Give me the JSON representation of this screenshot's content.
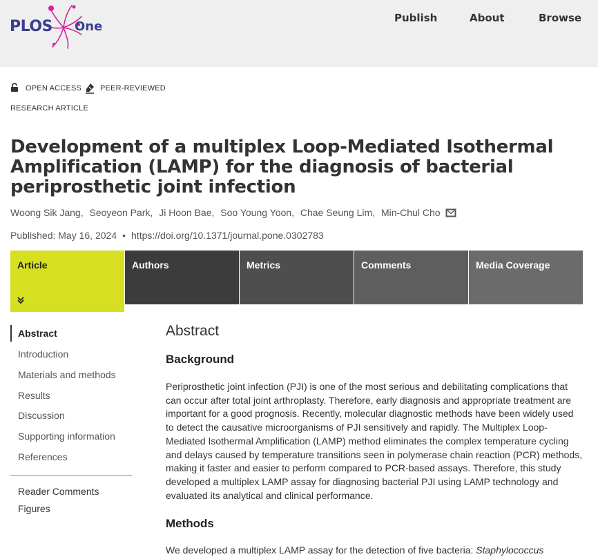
{
  "header": {
    "logo_text": "PLOS",
    "logo_sub": "One",
    "nav": [
      "Publish",
      "About",
      "Browse"
    ]
  },
  "badges": {
    "open_access": "OPEN ACCESS",
    "peer_reviewed": "PEER-REVIEWED"
  },
  "article_type": "RESEARCH ARTICLE",
  "title": "Development of a multiplex Loop-Mediated Isothermal Amplification (LAMP) for the diagnosis of bacterial periprosthetic joint infection",
  "authors": [
    "Woong Sik Jang,",
    "Seoyeon Park,",
    "Ji Hoon Bae,",
    "Soo Young Yoon,",
    "Chae Seung Lim,",
    "Min-Chul Cho"
  ],
  "published": {
    "date": "Published: May 16, 2024",
    "separator": "•",
    "doi": "https://doi.org/10.1371/journal.pone.0302783"
  },
  "tabs": [
    "Article",
    "Authors",
    "Metrics",
    "Comments",
    "Media Coverage"
  ],
  "sidenav": {
    "items": [
      "Abstract",
      "Introduction",
      "Materials and methods",
      "Results",
      "Discussion",
      "Supporting information",
      "References"
    ],
    "extra": [
      "Reader Comments",
      "Figures"
    ]
  },
  "main": {
    "abstract_heading": "Abstract",
    "background_heading": "Background",
    "background_text": "Periprosthetic joint infection (PJI) is one of the most serious and debilitating complications that can occur after total joint arthroplasty. Therefore, early diagnosis and appropriate treatment are important for a good prognosis. Recently, molecular diagnostic methods have been widely used to detect the causative microorganisms of PJI sensitively and rapidly. The Multiplex Loop-Mediated Isothermal Amplification (LAMP) method eliminates the complex temperature cycling and delays caused by temperature transitions seen in polymerase chain reaction (PCR) methods, making it faster and easier to perform compared to PCR-based assays. Therefore, this study developed a multiplex LAMP assay for diagnosing bacterial PJI using LAMP technology and evaluated its analytical and clinical performance.",
    "methods_heading": "Methods",
    "methods_text_start": "We developed a multiplex LAMP assay for the detection of five bacteria: ",
    "methods_text_italic": "Staphylococcus"
  },
  "colors": {
    "header_bg": "#efefef",
    "accent": "#d6e021",
    "logo_blue": "#3c3f8f",
    "logo_magenta": "#d4249a"
  }
}
